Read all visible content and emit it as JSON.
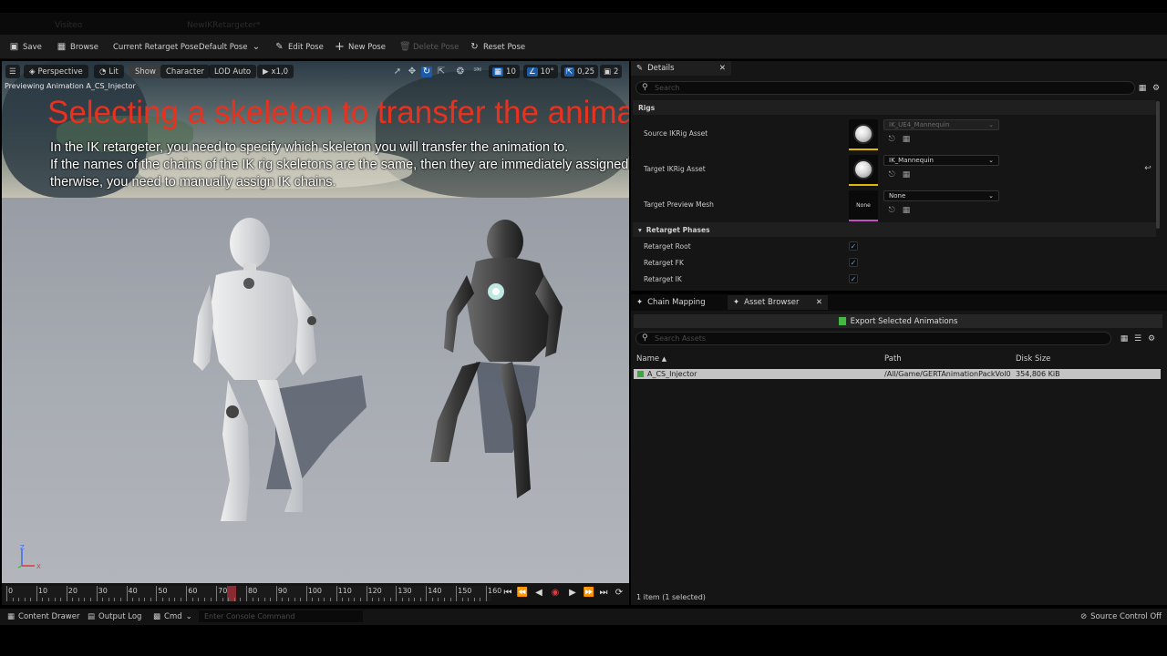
{
  "title_strip": {
    "ghost_tab_1": "Visiteo",
    "ghost_tab_2": "NewIKRetargeter*"
  },
  "toolbar": {
    "save_label": "Save",
    "browse_label": "Browse",
    "current_pose_label": "Current Retarget Pose:",
    "pose_value": "Default Pose",
    "edit_pose_label": "Edit Pose",
    "new_pose_label": "New Pose",
    "delete_pose_label": "Delete Pose",
    "reset_pose_label": "Reset Pose"
  },
  "viewport": {
    "perspective_label": "Perspective",
    "lit_label": "Lit",
    "show_label": "Show",
    "character_label": "Character",
    "lod_label": "LOD Auto",
    "play_rate": "x1,0",
    "grid_snap": "10",
    "rot_snap": "10°",
    "scale_snap": "0,25",
    "camera_speed": "2",
    "preview_text": "Previewing Animation A_CS_Injector",
    "overlay_title": "Selecting a skeleton to transfer the animation.",
    "overlay_line_1": "In the IK retargeter, you need to specify which skeleton you will transfer the animation to.",
    "overlay_line_2": "If the names of the chains of the IK rig skeletons are the same, then they are immediately assigned.",
    "overlay_line_3": "therwise, you need to manually assign IK chains.",
    "axis_z": "Z",
    "axis_x": "X"
  },
  "timeline": {
    "ticks": [
      "0",
      "10",
      "20",
      "30",
      "40",
      "50",
      "60",
      "70",
      "80",
      "90",
      "100",
      "110",
      "120",
      "130",
      "140",
      "150",
      "160"
    ],
    "current_frame": "75"
  },
  "details": {
    "tab_label": "Details",
    "search_placeholder": "Search",
    "section_rigs": "Rigs",
    "source_ikrig_label": "Source IKRig Asset",
    "source_ikrig_value": "IK_UE4_Mannequin",
    "target_ikrig_label": "Target IKRig Asset",
    "target_ikrig_value": "IK_Mannequin",
    "target_mesh_label": "Target Preview Mesh",
    "target_mesh_thumb": "None",
    "target_mesh_value": "None",
    "section_phases": "Retarget Phases",
    "retarget_root_label": "Retarget Root",
    "retarget_fk_label": "Retarget FK",
    "retarget_ik_label": "Retarget IK"
  },
  "tabs": {
    "chain_mapping": "Chain Mapping",
    "asset_browser": "Asset Browser"
  },
  "asset_browser": {
    "export_label": "Export Selected Animations",
    "search_placeholder": "Search Assets",
    "col_name": "Name",
    "col_path": "Path",
    "col_size": "Disk Size",
    "rows": [
      {
        "name": "A_CS_Injector",
        "path": "/All/Game/GERTAnimationPackVol0",
        "size": "354,806 KiB"
      }
    ],
    "status": "1 item (1 selected)"
  },
  "bottombar": {
    "content_drawer": "Content Drawer",
    "output_log": "Output Log",
    "cmd": "Cmd",
    "console_placeholder": "Enter Console Command",
    "source_control": "Source Control Off"
  },
  "colors": {
    "accent_blue": "#1d5aa8",
    "overlay_red": "#e8311f",
    "source_bar": "#e0b800",
    "target_bar": "#e0b800",
    "mesh_bar": "#c050c0"
  }
}
